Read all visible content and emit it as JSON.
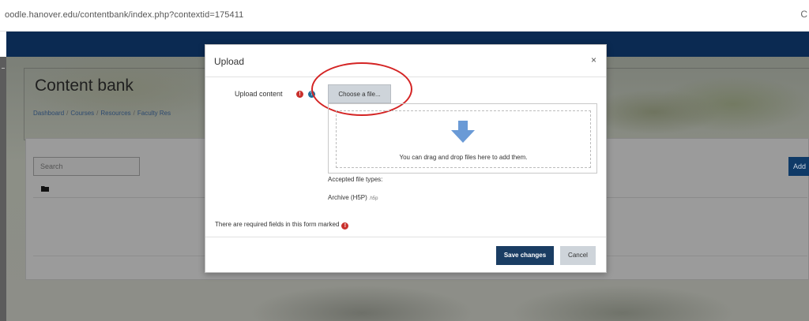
{
  "browser": {
    "url": "oodle.hanover.edu/contentbank/index.php?contextid=175411",
    "edge_glyph": "C"
  },
  "page": {
    "title": "Content bank",
    "breadcrumb": [
      "Dashboard",
      "Courses",
      "Resources",
      "Faculty Res"
    ],
    "breadcrumb_sep": "/",
    "search_placeholder": "Search",
    "add_label": "Add"
  },
  "modal": {
    "title": "Upload",
    "close": "×",
    "upload_label": "Upload content",
    "required_glyph": "!",
    "help_glyph": "?",
    "choose_file": "Choose a file...",
    "drop_text": "You can drag and drop files here to add them.",
    "accepted_label": "Accepted file types:",
    "accepted_value": "Archive (H5P)",
    "accepted_ext": ".h5p",
    "required_note": "There are required fields in this form marked",
    "save_label": "Save changes",
    "cancel_label": "Cancel"
  },
  "colors": {
    "navbar": "#0b2a52",
    "primary_button": "#1a3d63",
    "required": "#c9302c",
    "annotation": "#d42424",
    "drop_arrow": "#6a9ad6"
  },
  "icons": [
    "folder-icon",
    "arrow-down-icon",
    "close-icon",
    "required-icon",
    "help-icon"
  ]
}
